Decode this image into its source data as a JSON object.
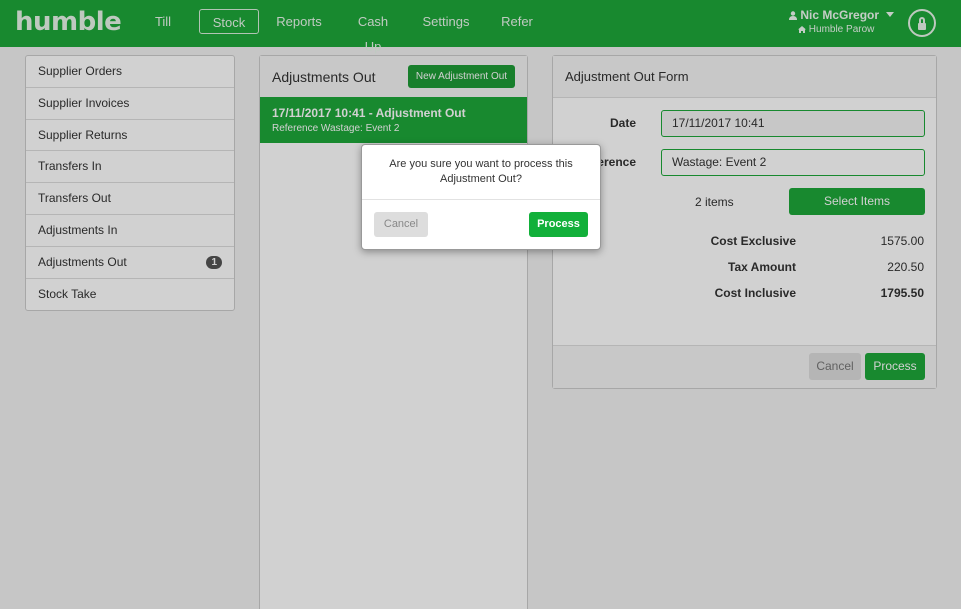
{
  "app": {
    "logo": "humble"
  },
  "nav": {
    "items": [
      {
        "label": "Till"
      },
      {
        "label": "Stock",
        "active": true
      },
      {
        "label": "Reports"
      },
      {
        "label": "Cash Up"
      },
      {
        "label": "Settings"
      },
      {
        "label": "Refer"
      }
    ]
  },
  "user": {
    "name": "Nic McGregor",
    "location": "Humble Parow",
    "dropdown_icon": "caret-down-icon",
    "person_icon": "user-icon",
    "home_icon": "home-icon",
    "lock_icon": "lock-icon"
  },
  "sidebar": {
    "items": [
      {
        "label": "Supplier Orders"
      },
      {
        "label": "Supplier Invoices"
      },
      {
        "label": "Supplier Returns"
      },
      {
        "label": "Transfers In"
      },
      {
        "label": "Transfers Out"
      },
      {
        "label": "Adjustments In"
      },
      {
        "label": "Adjustments Out",
        "badge": "1"
      },
      {
        "label": "Stock Take"
      }
    ]
  },
  "list_panel": {
    "title": "Adjustments Out",
    "new_button": "New Adjustment Out",
    "selected": {
      "title": "17/11/2017 10:41 - Adjustment Out",
      "subtitle": "Reference Wastage: Event 2"
    }
  },
  "form": {
    "title": "Adjustment Out Form",
    "date_label": "Date",
    "date_value": "17/11/2017 10:41",
    "reference_label": "Reference",
    "reference_value": "Wastage: Event 2",
    "items_count": "2 items",
    "select_items_button": "Select Items",
    "cost_exclusive_label": "Cost Exclusive",
    "cost_exclusive_value": "1575.00",
    "tax_amount_label": "Tax Amount",
    "tax_amount_value": "220.50",
    "cost_inclusive_label": "Cost Inclusive",
    "cost_inclusive_value": "1795.50",
    "cancel_button": "Cancel",
    "process_button": "Process"
  },
  "modal": {
    "message": "Are you sure you want to process this Adjustment Out?",
    "cancel_button": "Cancel",
    "process_button": "Process"
  },
  "colors": {
    "brand_green": "#1ea83a",
    "badge_gray": "#555555"
  }
}
